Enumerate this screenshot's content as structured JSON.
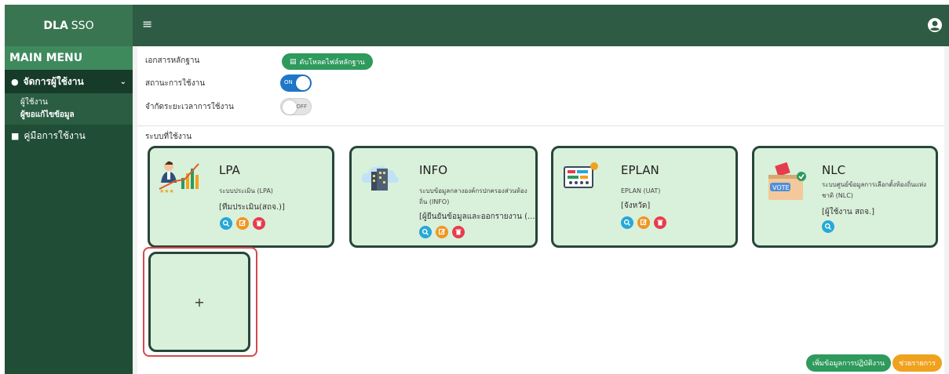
{
  "header": {
    "brand_bold": "DLA",
    "brand_rest": "SSO",
    "menu_icon": "hamburger-icon",
    "user_icon": "user-circle-icon"
  },
  "sidebar": {
    "title": "MAIN MENU",
    "active_item": "จัดการผู้ใช้งาน",
    "sub_items": [
      "ผู้ใช้งาน",
      "ผู้ขอแก้ไขข้อมูล"
    ],
    "manual_item": "คู่มือการใช้งาน"
  },
  "form": {
    "document_label": "เอกสารหลักฐาน",
    "document_button": "ดับโหลดไฟล์หลักฐาน",
    "status_label": "สถานะการใช้งาน",
    "status_toggle": "ON",
    "limit_label": "จำกัดระยะเวลาการใช้งาน",
    "limit_toggle": "OFF"
  },
  "systems_label": "ระบบที่ใช้งาน",
  "cards": [
    {
      "title": "LPA",
      "desc": "ระบบประเมิน (LPA)",
      "role": "[ทีมประเมิน(สถจ.)]"
    },
    {
      "title": "INFO",
      "desc": "ระบบข้อมูลกลางองค์กรปกครองส่วนท้องถิ่น (INFO)",
      "role": "[ผู้ยืนยันข้อมูลและออกรายงาน (..."
    },
    {
      "title": "EPLAN",
      "desc": "EPLAN (UAT)",
      "role": "[จังหวัด]"
    },
    {
      "title": "NLC",
      "desc": "ระบบศูนย์ข้อมูลการเลือกตั้งท้องถิ่นแห่งชาติ (NLC)",
      "role": "[ผู้ใช้งาน สถจ.]"
    }
  ],
  "add_label": "+",
  "vote_label": "VOTE",
  "footer": {
    "add_button": "เพิ่มข้อมูลการปฏิบัติงาน",
    "help_button": "ช่วยรายการ"
  },
  "colors": {
    "topbar": "#2e5b44",
    "sidebar": "#1f4d35",
    "card_bg": "#d9f0da",
    "card_border": "#28463a",
    "accent_green": "#2e9a5c",
    "accent_orange": "#f0a21e",
    "highlight_red": "#d44a4a"
  }
}
